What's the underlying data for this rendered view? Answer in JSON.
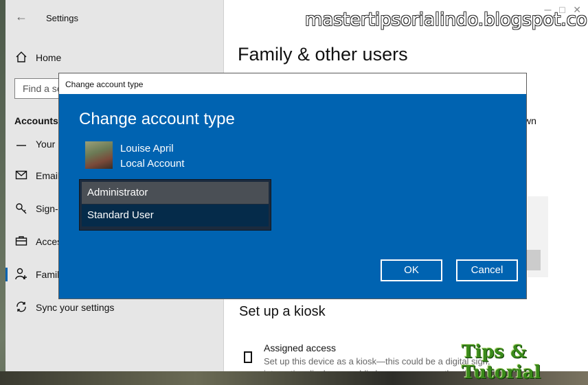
{
  "settings": {
    "window_title": "Settings",
    "home_label": "Home",
    "find_placeholder": "Find a se",
    "section_heading": "Accounts",
    "nav_items": [
      {
        "label": "Your",
        "icon": "user-info-icon"
      },
      {
        "label": "Email",
        "icon": "mail-icon"
      },
      {
        "label": "Sign-",
        "icon": "key-icon"
      },
      {
        "label": "Acces",
        "icon": "briefcase-icon"
      },
      {
        "label": "Family",
        "icon": "family-icon"
      },
      {
        "label": "Sync your settings",
        "icon": "sync-icon"
      }
    ],
    "content_title": "Family & other users",
    "partial_text": "wn",
    "kiosk_title": "Set up a kiosk",
    "assigned_title": "Assigned access",
    "assigned_desc": "Set up this device as a kiosk—this could be a digital sign, interactive display, or public browser among other things."
  },
  "dialog": {
    "titlebar": "Change account type",
    "heading": "Change account type",
    "user_name": "Louise April",
    "user_type": "Local Account",
    "options": [
      "Administrator",
      "Standard User"
    ],
    "ok_label": "OK",
    "cancel_label": "Cancel",
    "accent_color": "#0063b1"
  },
  "watermarks": {
    "top": "mastertipsorialindo.blogspot.com",
    "logo": "Tips & Tutorial"
  }
}
